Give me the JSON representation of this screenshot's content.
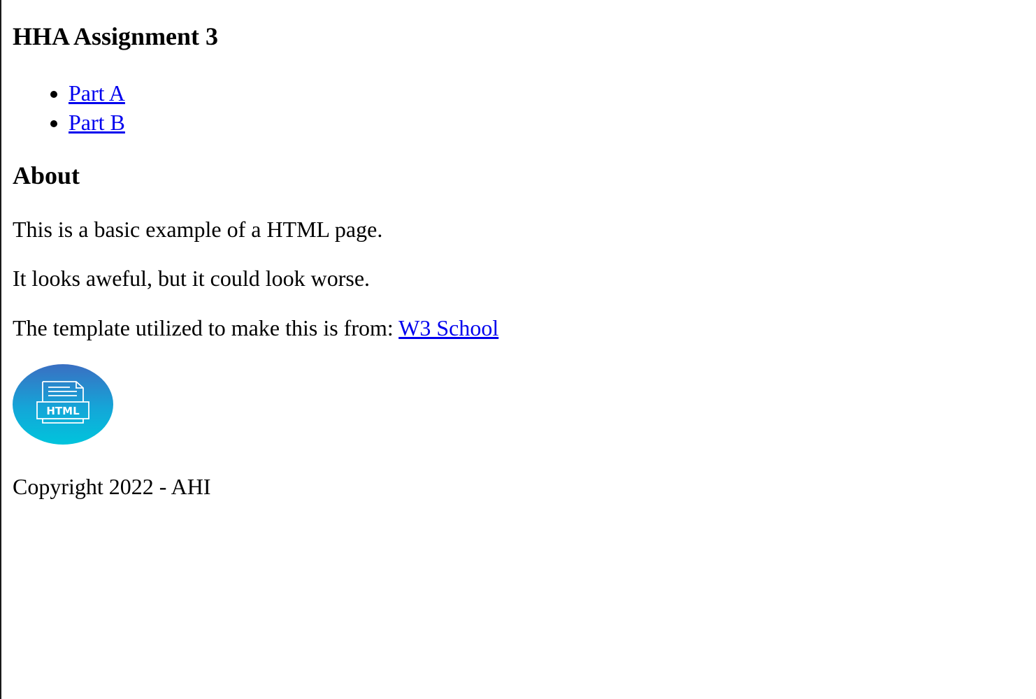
{
  "header": {
    "title": "HHA Assignment 3"
  },
  "nav": {
    "items": [
      {
        "label": "Part A"
      },
      {
        "label": "Part B"
      }
    ]
  },
  "about": {
    "heading": "About",
    "line1": "This is a basic example of a HTML page.",
    "line2": "It looks aweful, but it could look worse.",
    "line3_prefix": "The template utilized to make this is from: ",
    "line3_link": "W3 School"
  },
  "logo": {
    "icon": "html-file-icon",
    "label": "HTML",
    "colors": {
      "top": "#3a6fc2",
      "bottom": "#00c4dc",
      "stroke": "#ffffff"
    }
  },
  "footer": {
    "copyright": "Copyright 2022 - AHI"
  },
  "colors": {
    "link": "#0000ee",
    "text": "#000000",
    "background": "#ffffff"
  }
}
